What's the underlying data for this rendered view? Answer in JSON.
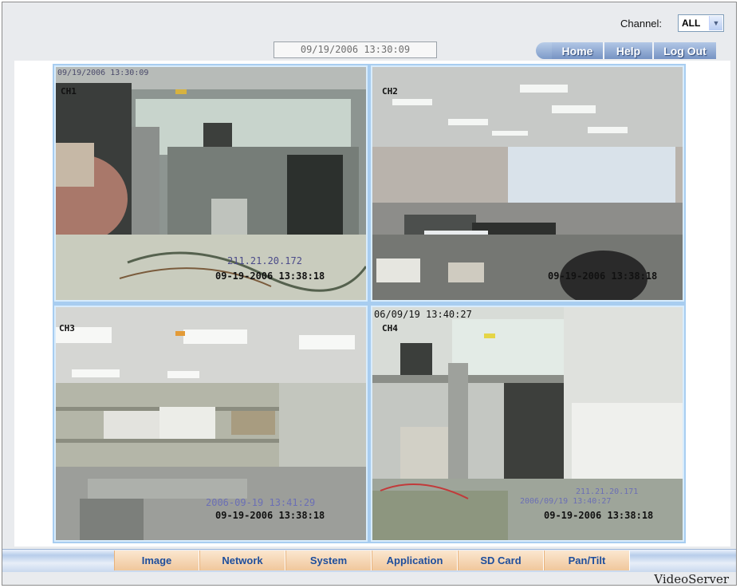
{
  "header": {
    "channel_label": "Channel:",
    "channel_value": "ALL",
    "datetime": "09/19/2006 13:30:09"
  },
  "topnav": {
    "home": "Home",
    "help": "Help",
    "logout": "Log Out"
  },
  "cameras": [
    {
      "label": "CH1",
      "overlay_top": "09/19/2006 13:30:09",
      "overlay_ip": "211.21.20.172",
      "timestamp": "09-19-2006 13:38:18"
    },
    {
      "label": "CH2",
      "timestamp": "09-19-2006 13:38:18"
    },
    {
      "label": "CH3",
      "overlay_ip": "2006-09-19 13:41:29",
      "timestamp": "09-19-2006 13:38:18"
    },
    {
      "label": "CH4",
      "overlay_top": "06/09/19 13:40:27",
      "overlay_ip": "211.21.20.171",
      "overlay_ip2": "2006/09/19 13:40:27",
      "timestamp": "09-19-2006 13:38:18"
    }
  ],
  "tabs": [
    "Image",
    "Network",
    "System",
    "Application",
    "SD Card",
    "Pan/Tilt"
  ],
  "footer": {
    "brand": "VideoServer"
  },
  "colors": {
    "tab_text": "#1e4e9c",
    "tab_bg": "#f0c79c",
    "nav_bg": "#7693c3",
    "grid_border": "#a8cdf0"
  }
}
